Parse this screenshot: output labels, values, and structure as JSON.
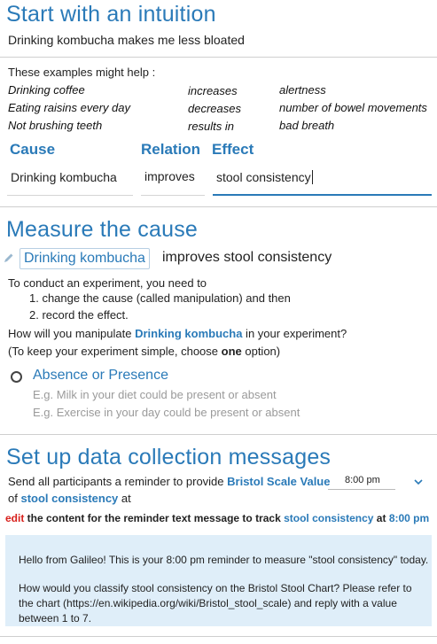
{
  "section1": {
    "title": "Start with an intuition",
    "intuition": "Drinking kombucha makes me less bloated",
    "examples_label": "These examples might help :",
    "examples": [
      {
        "cause": "Drinking coffee",
        "relation": "increases",
        "effect": "alertness"
      },
      {
        "cause": "Eating raisins every day",
        "relation": "decreases",
        "effect": "number of bowel movements"
      },
      {
        "cause": "Not brushing teeth",
        "relation": "results in",
        "effect": "bad breath"
      }
    ],
    "cause_header": "Cause",
    "relation_header": "Relation",
    "effect_header": "Effect",
    "cause_value": "Drinking kombucha",
    "relation_value": "improves",
    "effect_value": "stool consistency"
  },
  "section2": {
    "title": "Measure the cause",
    "cause_chip": "Drinking kombucha",
    "statement_rest": "improves stool consistency",
    "intro": "To conduct an experiment, you need to",
    "step1": "1. change the cause (called manipulation) and then",
    "step2": "2. record the effect.",
    "question_pre": "How will you manipulate ",
    "question_cause": "Drinking kombucha",
    "question_post": " in your experiment?",
    "hint_pre": "(To keep your experiment simple, choose ",
    "hint_bold": "one",
    "hint_post": " option)",
    "option_label": "Absence or Presence",
    "option_example1": "E.g. Milk in your diet could be present or absent",
    "option_example2": "E.g. Exercise in your day could be present or absent"
  },
  "section3": {
    "title": "Set up data collection messages",
    "send_pre": "Send all participants a reminder to provide ",
    "send_value": "Bristol Scale Value",
    "time_value": "8:00 pm",
    "of_word": "of ",
    "of_effect": "stool consistency",
    "at_word": " at",
    "edit_link": "edit",
    "edit_text": " the content for the reminder text message to track ",
    "edit_effect": "stool consistency",
    "edit_at": " at ",
    "edit_time": "8:00 pm",
    "msg_line1": "Hello from Galileo! This is your 8:00 pm reminder to measure \"stool consistency\" today.",
    "msg_line2": "How would you classify stool consistency on the Bristol Stool Chart? Please refer to the chart (https://en.wikipedia.org/wiki/Bristol_stool_scale) and reply with a value between 1 to 7."
  },
  "colors": {
    "accent": "#2a7ab8",
    "edit": "#d8201c",
    "message_bg": "#dfeef9"
  },
  "icons": [
    "pencil-icon",
    "radio-icon",
    "chevron-down-icon"
  ]
}
